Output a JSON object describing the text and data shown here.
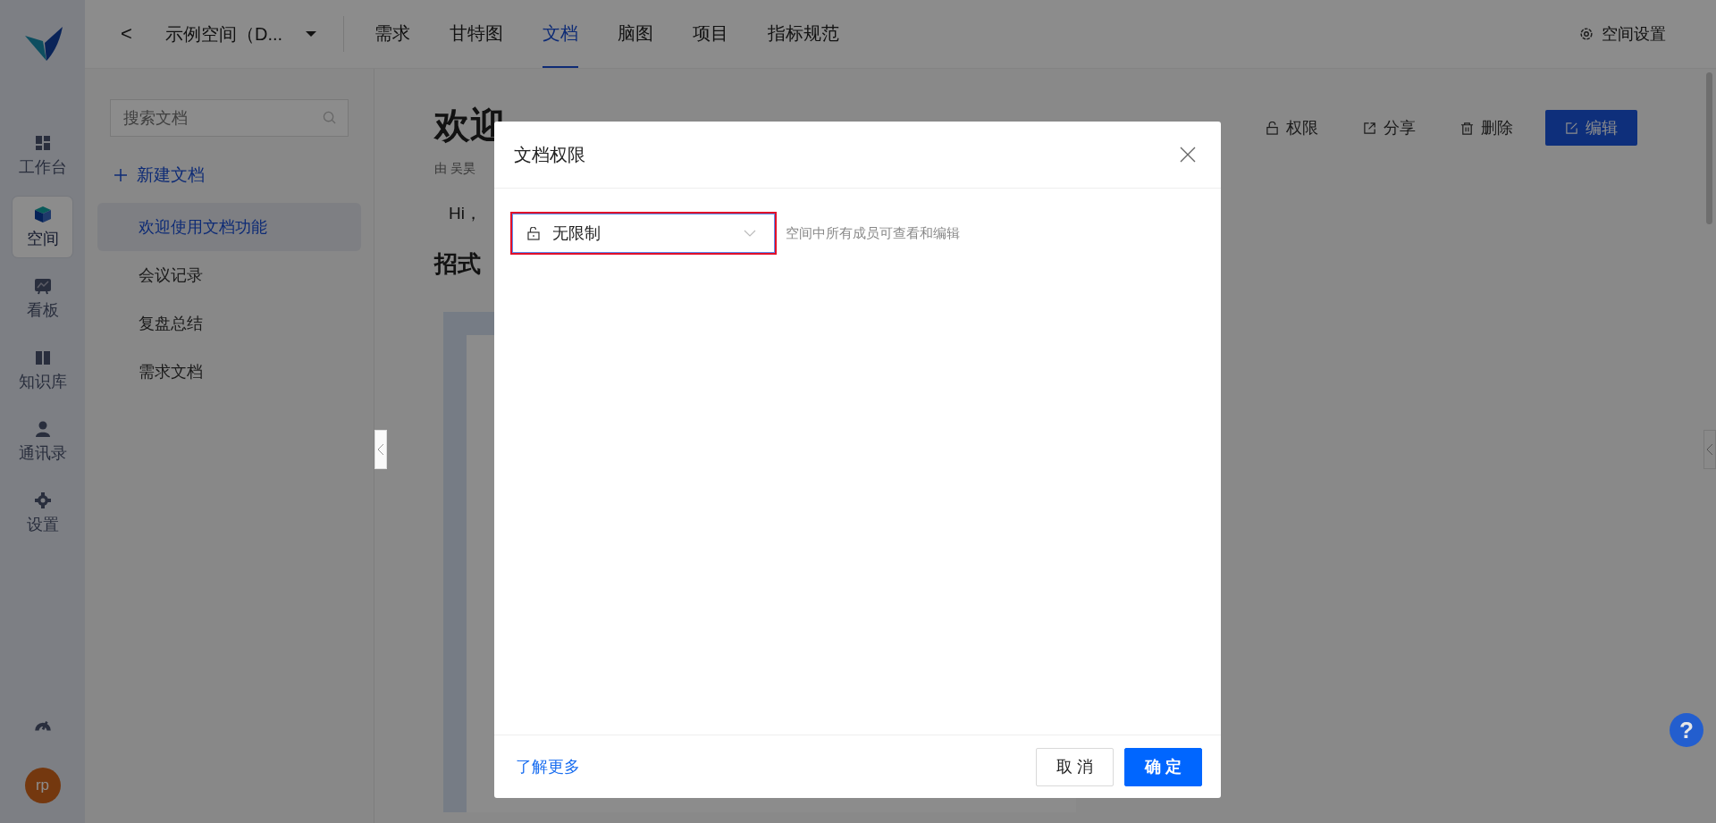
{
  "rail": {
    "items": [
      {
        "kind": "grid",
        "label": "工作台",
        "selected": false
      },
      {
        "kind": "cube",
        "label": "空间",
        "selected": true
      },
      {
        "kind": "chart",
        "label": "看板",
        "selected": false
      },
      {
        "kind": "book",
        "label": "知识库",
        "selected": false
      },
      {
        "kind": "person",
        "label": "通讯录",
        "selected": false
      },
      {
        "kind": "gear",
        "label": "设置",
        "selected": false
      }
    ],
    "avatar": "rp"
  },
  "topbar": {
    "back": "<",
    "space": "示例空间（D...",
    "tabs": [
      {
        "label": "需求",
        "selected": false
      },
      {
        "label": "甘特图",
        "selected": false
      },
      {
        "label": "文档",
        "selected": true
      },
      {
        "label": "脑图",
        "selected": false
      },
      {
        "label": "项目",
        "selected": false
      },
      {
        "label": "指标规范",
        "selected": false
      }
    ],
    "settings": "空间设置"
  },
  "sidebar": {
    "search": {
      "placeholder": "搜索文档"
    },
    "new_doc": "新建文档",
    "items": [
      {
        "label": "欢迎使用文档功能",
        "selected": true
      },
      {
        "label": "会议记录",
        "selected": false
      },
      {
        "label": "复盘总结",
        "selected": false
      },
      {
        "label": "需求文档",
        "selected": false
      }
    ]
  },
  "document": {
    "title": "欢迎",
    "meta": "由 吴昊",
    "greeting": "Hi，",
    "heading": "招式",
    "actions": [
      {
        "kind": "lock",
        "label": "权限"
      },
      {
        "kind": "share",
        "label": "分享"
      },
      {
        "kind": "trash",
        "label": "删除"
      },
      {
        "kind": "primary",
        "label": "编辑"
      }
    ]
  },
  "dialog": {
    "title": "文档权限",
    "select": {
      "value": "无限制",
      "highlighted": true
    },
    "description": "空间中所有成员可查看和编辑",
    "link": "了解更多",
    "buttons": [
      {
        "kind": "default",
        "label": "取 消"
      },
      {
        "kind": "primary",
        "label": "确 定"
      }
    ]
  },
  "help": "?"
}
